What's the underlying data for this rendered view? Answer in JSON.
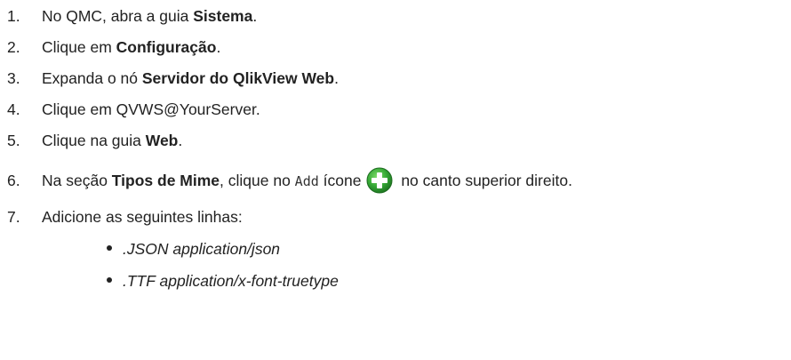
{
  "steps": [
    {
      "num": "1.",
      "pre": "No QMC, abra a guia ",
      "bold": "Sistema",
      "post": "."
    },
    {
      "num": "2.",
      "pre": "Clique em ",
      "bold": "Configuração",
      "post": "."
    },
    {
      "num": "3.",
      "pre": "Expanda o nó ",
      "bold": "Servidor do QlikView Web",
      "post": "."
    },
    {
      "num": "4.",
      "text": "Clique em QVWS@YourServer."
    },
    {
      "num": "5.",
      "pre": "Clique na guia ",
      "bold": "Web",
      "post": "."
    },
    {
      "num": "6.",
      "pre": "Na seção ",
      "bold": "Tipos de Mime",
      "mid": ", clique no ",
      "code": "Add",
      "after_code": " ícone",
      "post": " no canto superior direito.",
      "icon": "add-plus-circle-icon"
    },
    {
      "num": "7.",
      "text": "Adicione as seguintes linhas:"
    }
  ],
  "bullets": [
    ".JSON application/json",
    ".TTF application/x-font-truetype"
  ],
  "colors": {
    "text": "#222222",
    "icon_green": "#35a835"
  }
}
